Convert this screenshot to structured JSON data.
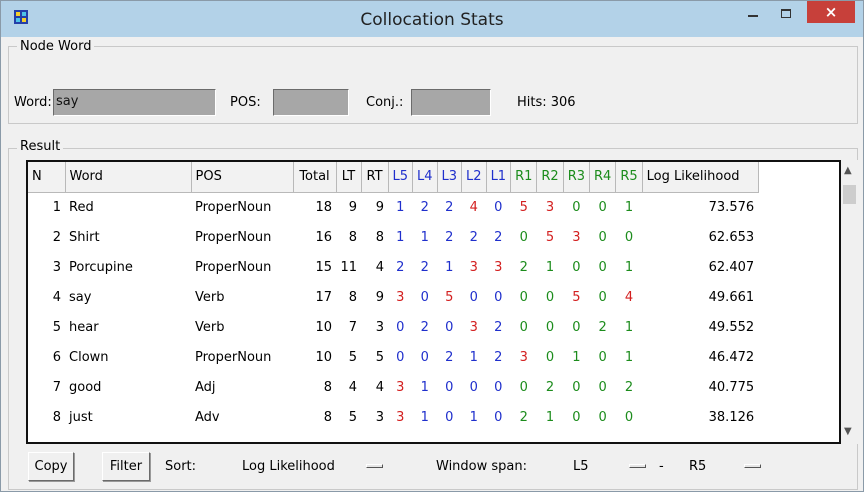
{
  "window": {
    "title": "Collocation Stats",
    "close_glyph": "×"
  },
  "node_word": {
    "legend": "Node Word",
    "word_label": "Word:",
    "word_value": "say",
    "pos_label": "POS:",
    "pos_value": "",
    "conj_label": "Conj.:",
    "conj_value": "",
    "hits_text": "Hits: 306"
  },
  "result": {
    "legend": "Result",
    "columns": [
      "N",
      "Word",
      "POS",
      "Total",
      "LT",
      "RT",
      "L5",
      "L4",
      "L3",
      "L2",
      "L1",
      "R1",
      "R2",
      "R3",
      "R4",
      "R5",
      "Log Likelihood"
    ],
    "rows": [
      [
        "1",
        "Red",
        "ProperNoun",
        "18",
        "9",
        "9",
        "1",
        "2",
        "2",
        "4",
        "0",
        "5",
        "3",
        "0",
        "0",
        "1",
        "73.576"
      ],
      [
        "2",
        "Shirt",
        "ProperNoun",
        "16",
        "8",
        "8",
        "1",
        "1",
        "2",
        "2",
        "2",
        "0",
        "5",
        "3",
        "0",
        "0",
        "62.653"
      ],
      [
        "3",
        "Porcupine",
        "ProperNoun",
        "15",
        "11",
        "4",
        "2",
        "2",
        "1",
        "3",
        "3",
        "2",
        "1",
        "0",
        "0",
        "1",
        "62.407"
      ],
      [
        "4",
        "say",
        "Verb",
        "17",
        "8",
        "9",
        "3",
        "0",
        "5",
        "0",
        "0",
        "0",
        "0",
        "5",
        "0",
        "4",
        "49.661"
      ],
      [
        "5",
        "hear",
        "Verb",
        "10",
        "7",
        "3",
        "0",
        "2",
        "0",
        "3",
        "2",
        "0",
        "0",
        "0",
        "2",
        "1",
        "49.552"
      ],
      [
        "6",
        "Clown",
        "ProperNoun",
        "10",
        "5",
        "5",
        "0",
        "0",
        "2",
        "1",
        "2",
        "3",
        "0",
        "1",
        "0",
        "1",
        "46.472"
      ],
      [
        "7",
        "good",
        "Adj",
        "8",
        "4",
        "4",
        "3",
        "1",
        "0",
        "0",
        "0",
        "0",
        "2",
        "0",
        "0",
        "2",
        "40.775"
      ],
      [
        "8",
        "just",
        "Adv",
        "8",
        "5",
        "3",
        "3",
        "1",
        "0",
        "1",
        "0",
        "2",
        "1",
        "0",
        "0",
        "0",
        "38.126"
      ]
    ]
  },
  "toolbar": {
    "copy_label": "Copy",
    "filter_label": "Filter",
    "sort_label": "Sort:",
    "sort_value": "Log Likelihood",
    "span_label": "Window span:",
    "span_from": "L5",
    "span_sep": "-",
    "span_to": "R5"
  },
  "colors": {
    "left_cols": "#1f2fcc",
    "right_cols": "#1c8c1c",
    "highlight": "#d32020",
    "titlebar": "#b3d2e8",
    "close": "#c7403a"
  }
}
